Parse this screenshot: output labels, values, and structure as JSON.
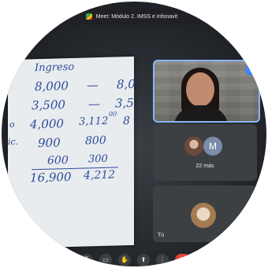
{
  "window": {
    "title": "Meet: Módulo 2. IMSS e Infonavit"
  },
  "board": {
    "lines": [
      {
        "id": "header",
        "text": "Ingreso"
      },
      {
        "id": "r1a",
        "text": "8,000"
      },
      {
        "id": "r1b",
        "text": "—"
      },
      {
        "id": "r1c",
        "text": "8,0"
      },
      {
        "id": "r2a",
        "text": "3,500"
      },
      {
        "id": "r2b",
        "text": "—"
      },
      {
        "id": "r2c",
        "text": "3,5"
      },
      {
        "id": "r3a",
        "text": "4,000"
      },
      {
        "id": "r3b",
        "text": "3,112"
      },
      {
        "id": "r3b_sup",
        "text": "00"
      },
      {
        "id": "r3c",
        "text": "8"
      },
      {
        "id": "r4a",
        "text": "900"
      },
      {
        "id": "r4b",
        "text": "800"
      },
      {
        "id": "r5a",
        "text": "600"
      },
      {
        "id": "r5b",
        "text": "300"
      },
      {
        "id": "r6a",
        "text": "16,900"
      },
      {
        "id": "r6b",
        "text": "4,212"
      },
      {
        "id": "left1",
        "text": "o"
      },
      {
        "id": "left2",
        "text": "ic."
      }
    ]
  },
  "participants": {
    "more_label": "22 más",
    "avatar_letter": "M",
    "self_label": "Tú"
  },
  "colors": {
    "accent": "#8ab4f8",
    "end_call": "#ea4335",
    "tile": "#3c4043"
  },
  "controls": {
    "icons": [
      "mic-icon",
      "camera-icon",
      "hand-icon",
      "present-icon",
      "more-icon",
      "end-call-icon"
    ]
  }
}
